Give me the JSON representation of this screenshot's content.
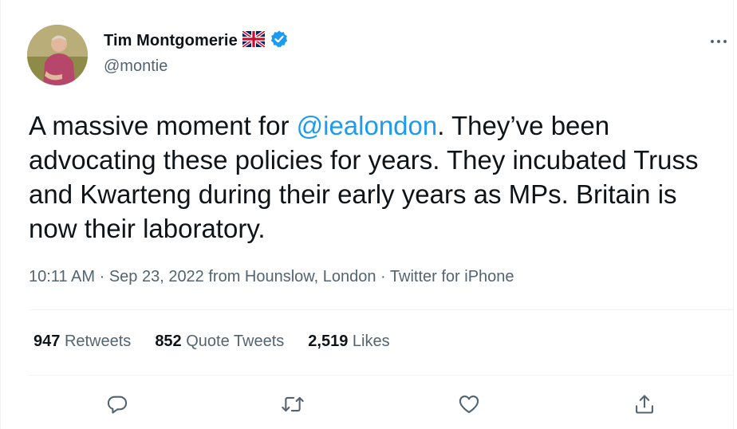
{
  "author": {
    "display_name": "Tim Montgomerie",
    "handle": "@montie",
    "flag_icon": "uk-flag-icon",
    "verified_icon": "verified-badge-icon"
  },
  "tweet": {
    "text_before": "A massive moment for ",
    "mention": "@iealondon",
    "text_after": ". They’ve been advocating these policies for years. They incubated Truss and Kwarteng during their early years as MPs. Britain is now their laboratory."
  },
  "meta": {
    "time": "10:11 AM",
    "separator1": " · ",
    "date": "Sep 23, 2022",
    "location": " from Hounslow, London",
    "separator2": " · ",
    "source": "Twitter for iPhone"
  },
  "stats": {
    "retweets_count": "947",
    "retweets_label": "Retweets",
    "quotes_count": "852",
    "quotes_label": "Quote Tweets",
    "likes_count": "2,519",
    "likes_label": "Likes"
  },
  "actions": {
    "reply_icon": "reply-icon",
    "retweet_icon": "retweet-icon",
    "like_icon": "heart-icon",
    "share_icon": "share-icon",
    "more_icon": "more-icon"
  },
  "colors": {
    "accent": "#1d9bf0",
    "text_primary": "#0f1419",
    "text_secondary": "#536471",
    "divider": "#eff3f4"
  }
}
